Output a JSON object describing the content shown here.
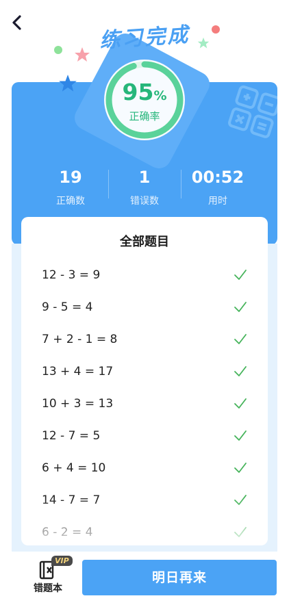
{
  "header": {
    "banner_title": "练习完成"
  },
  "result": {
    "accuracy_value": "95",
    "accuracy_unit": "%",
    "accuracy_label": "正确率",
    "accuracy_fraction": 0.95
  },
  "stats": [
    {
      "value": "19",
      "label": "正确数"
    },
    {
      "value": "1",
      "label": "错误数"
    },
    {
      "value": "00:52",
      "label": "用时"
    }
  ],
  "list": {
    "title": "全部题目",
    "items": [
      {
        "expr": "12 - 3 = 9",
        "status": "correct"
      },
      {
        "expr": "9 - 5 = 4",
        "status": "correct"
      },
      {
        "expr": "7 + 2 - 1 = 8",
        "status": "correct"
      },
      {
        "expr": "13 + 4 = 17",
        "status": "correct"
      },
      {
        "expr": "10 + 3 = 13",
        "status": "correct"
      },
      {
        "expr": "12 - 7 = 5",
        "status": "correct"
      },
      {
        "expr": "6 + 4 = 10",
        "status": "correct"
      },
      {
        "expr": "14 - 7 = 7",
        "status": "correct"
      },
      {
        "expr": "6 - 2 = 4",
        "status": "correct"
      }
    ]
  },
  "footer": {
    "wrong_book_label": "错题本",
    "vip_badge": "VIP",
    "again_button": "明日再来"
  },
  "colors": {
    "primary": "#4ba3f5",
    "success": "#26b67a",
    "check": "#45b35a"
  }
}
